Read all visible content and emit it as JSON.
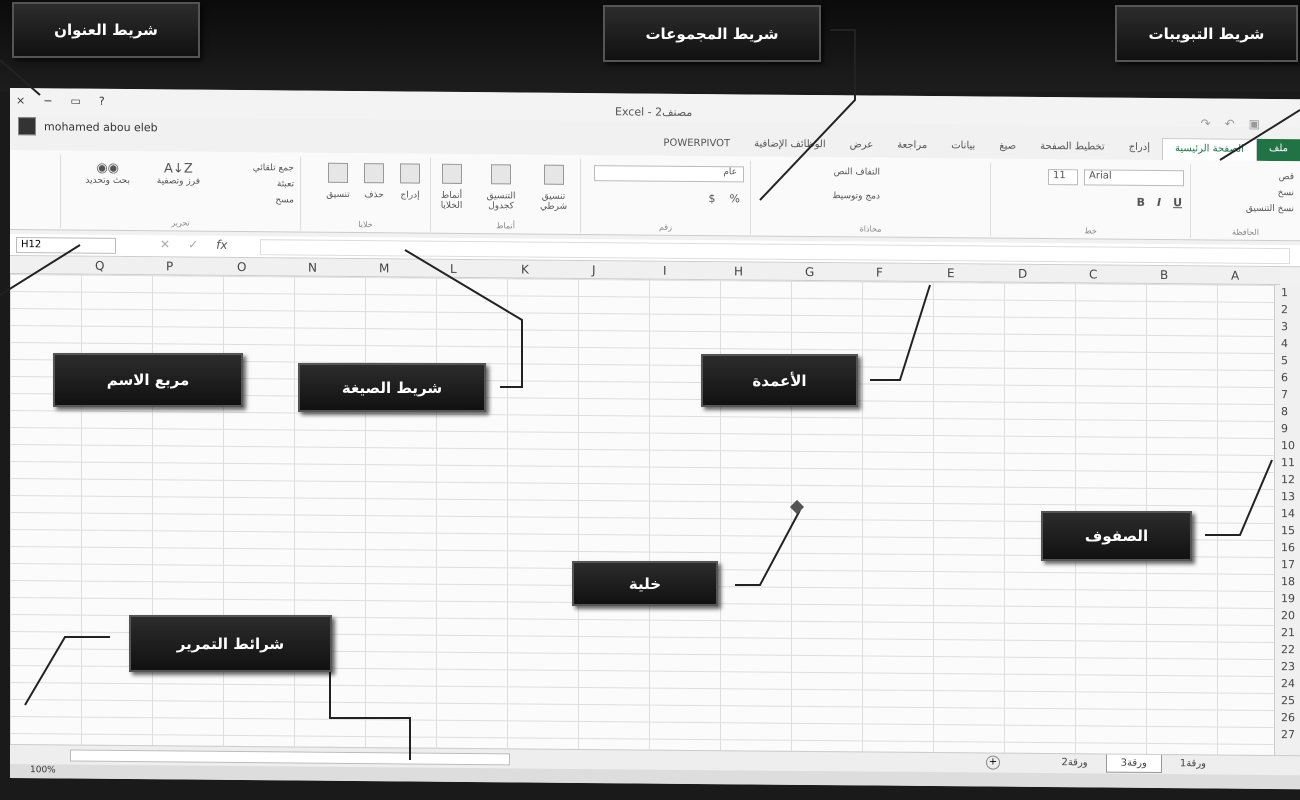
{
  "window": {
    "close": "×",
    "minimize": "−",
    "restore": "▭",
    "help": "?",
    "title": "Excel - مصنف2",
    "user": "mohamed abou eleb"
  },
  "tabs": [
    {
      "label": "ملف",
      "type": "file"
    },
    {
      "label": "الصفحة الرئيسية",
      "type": "active"
    },
    {
      "label": "إدراج"
    },
    {
      "label": "تخطيط الصفحة"
    },
    {
      "label": "صيغ"
    },
    {
      "label": "بيانات"
    },
    {
      "label": "مراجعة"
    },
    {
      "label": "عرض"
    },
    {
      "label": "الوظائف الإضافية"
    },
    {
      "label": "POWERPIVOT"
    }
  ],
  "ribbon": {
    "clipboard": {
      "cut": "قص",
      "copy": "نسخ",
      "paste_format": "نسخ التنسيق",
      "label": "الحافظة"
    },
    "font": {
      "name": "Arial",
      "size": "11",
      "bold": "B",
      "italic": "I",
      "underline": "U",
      "label": "خط"
    },
    "alignment": {
      "wrap": "التفاف النص",
      "merge": "دمج وتوسيط",
      "label": "محاذاة"
    },
    "number": {
      "format": "عام",
      "currency": "$",
      "percent": "%",
      "label": "رقم"
    },
    "styles": {
      "cond": "تنسيق شرطي",
      "table": "التنسيق كجدول",
      "cell": "أنماط الخلايا",
      "label": "أنماط"
    },
    "cells": {
      "insert": "إدراج",
      "delete": "حذف",
      "format": "تنسيق",
      "label": "خلايا"
    },
    "editing": {
      "sum": "جمع تلقائي",
      "fill": "تعبئة",
      "clear": "مسح",
      "sort": "فرز وتصفية",
      "find": "بحث وتحديد",
      "label": "تحرير"
    }
  },
  "formula": {
    "namebox": "H12",
    "fx": "fx",
    "cancel": "✕",
    "enter": "✓"
  },
  "columns": [
    "Q",
    "P",
    "O",
    "N",
    "M",
    "L",
    "K",
    "J",
    "I",
    "H",
    "G",
    "F",
    "E",
    "D",
    "C",
    "B",
    "A"
  ],
  "rows": [
    "1",
    "2",
    "3",
    "4",
    "5",
    "6",
    "7",
    "8",
    "9",
    "10",
    "11",
    "12",
    "13",
    "14",
    "15",
    "16",
    "17",
    "18",
    "19",
    "20",
    "21",
    "22",
    "23",
    "24",
    "25",
    "26",
    "27"
  ],
  "sheets": [
    "ورقة1",
    "ورقة3",
    "ورقة2"
  ],
  "add_sheet": "+",
  "zoom": "100%",
  "callouts": {
    "title_bar": "شريط العنوان",
    "groups_bar": "شريط المجموعات",
    "tabs_bar": "شريط التبويبات",
    "name_box": "مربع الاسم",
    "formula_bar": "شريط الصيغة",
    "columns": "الأعمدة",
    "rows": "الصفوف",
    "cell": "خلية",
    "scrollbars": "شرائط التمرير"
  }
}
